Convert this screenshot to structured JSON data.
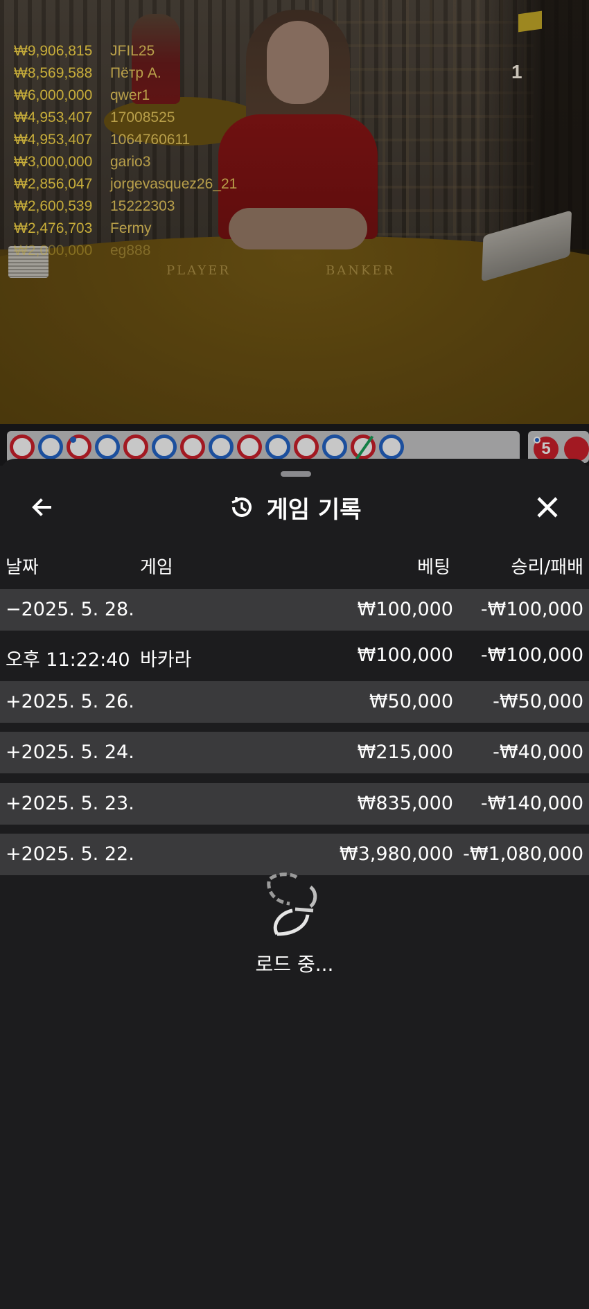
{
  "video": {
    "round_number": "1",
    "table_labels": {
      "player": "PLAYER",
      "banker": "BANKER"
    },
    "leaderboard": [
      {
        "amount": "₩9,906,815",
        "name": "JFIL25"
      },
      {
        "amount": "₩8,569,588",
        "name": "Пётр А."
      },
      {
        "amount": "₩6,000,000",
        "name": "qwer1"
      },
      {
        "amount": "₩4,953,407",
        "name": "17008525"
      },
      {
        "amount": "₩4,953,407",
        "name": "1064760611"
      },
      {
        "amount": "₩3,000,000",
        "name": "gario3"
      },
      {
        "amount": "₩2,856,047",
        "name": "jorgevasquez26_21"
      },
      {
        "amount": "₩2,600,539",
        "name": "15222303"
      },
      {
        "amount": "₩2,476,703",
        "name": "Fermy"
      },
      {
        "amount": "₩2,000,000",
        "name": "eg888"
      }
    ]
  },
  "road": {
    "side_badge": "5"
  },
  "sheet": {
    "title": "게임 기록",
    "headers": {
      "date": "날짜",
      "game": "게임",
      "bet": "베팅",
      "win_loss": "승리/패배"
    },
    "rows": [
      {
        "date": "−2025. 5. 28.",
        "game": "",
        "bet": "₩100,000",
        "win_loss": "-₩100,000"
      },
      {
        "date": "오후 11:22:40",
        "game": "바카라",
        "bet": "₩100,000",
        "win_loss": "-₩100,000"
      },
      {
        "date": "+2025. 5. 26.",
        "game": "",
        "bet": "₩50,000",
        "win_loss": "-₩50,000"
      },
      {
        "date": "+2025. 5. 24.",
        "game": "",
        "bet": "₩215,000",
        "win_loss": "-₩40,000"
      },
      {
        "date": "+2025. 5. 23.",
        "game": "",
        "bet": "₩835,000",
        "win_loss": "-₩140,000"
      },
      {
        "date": "+2025. 5. 22.",
        "game": "",
        "bet": "₩3,980,000",
        "win_loss": "-₩1,080,000"
      }
    ],
    "loading_text": "로드 중..."
  }
}
